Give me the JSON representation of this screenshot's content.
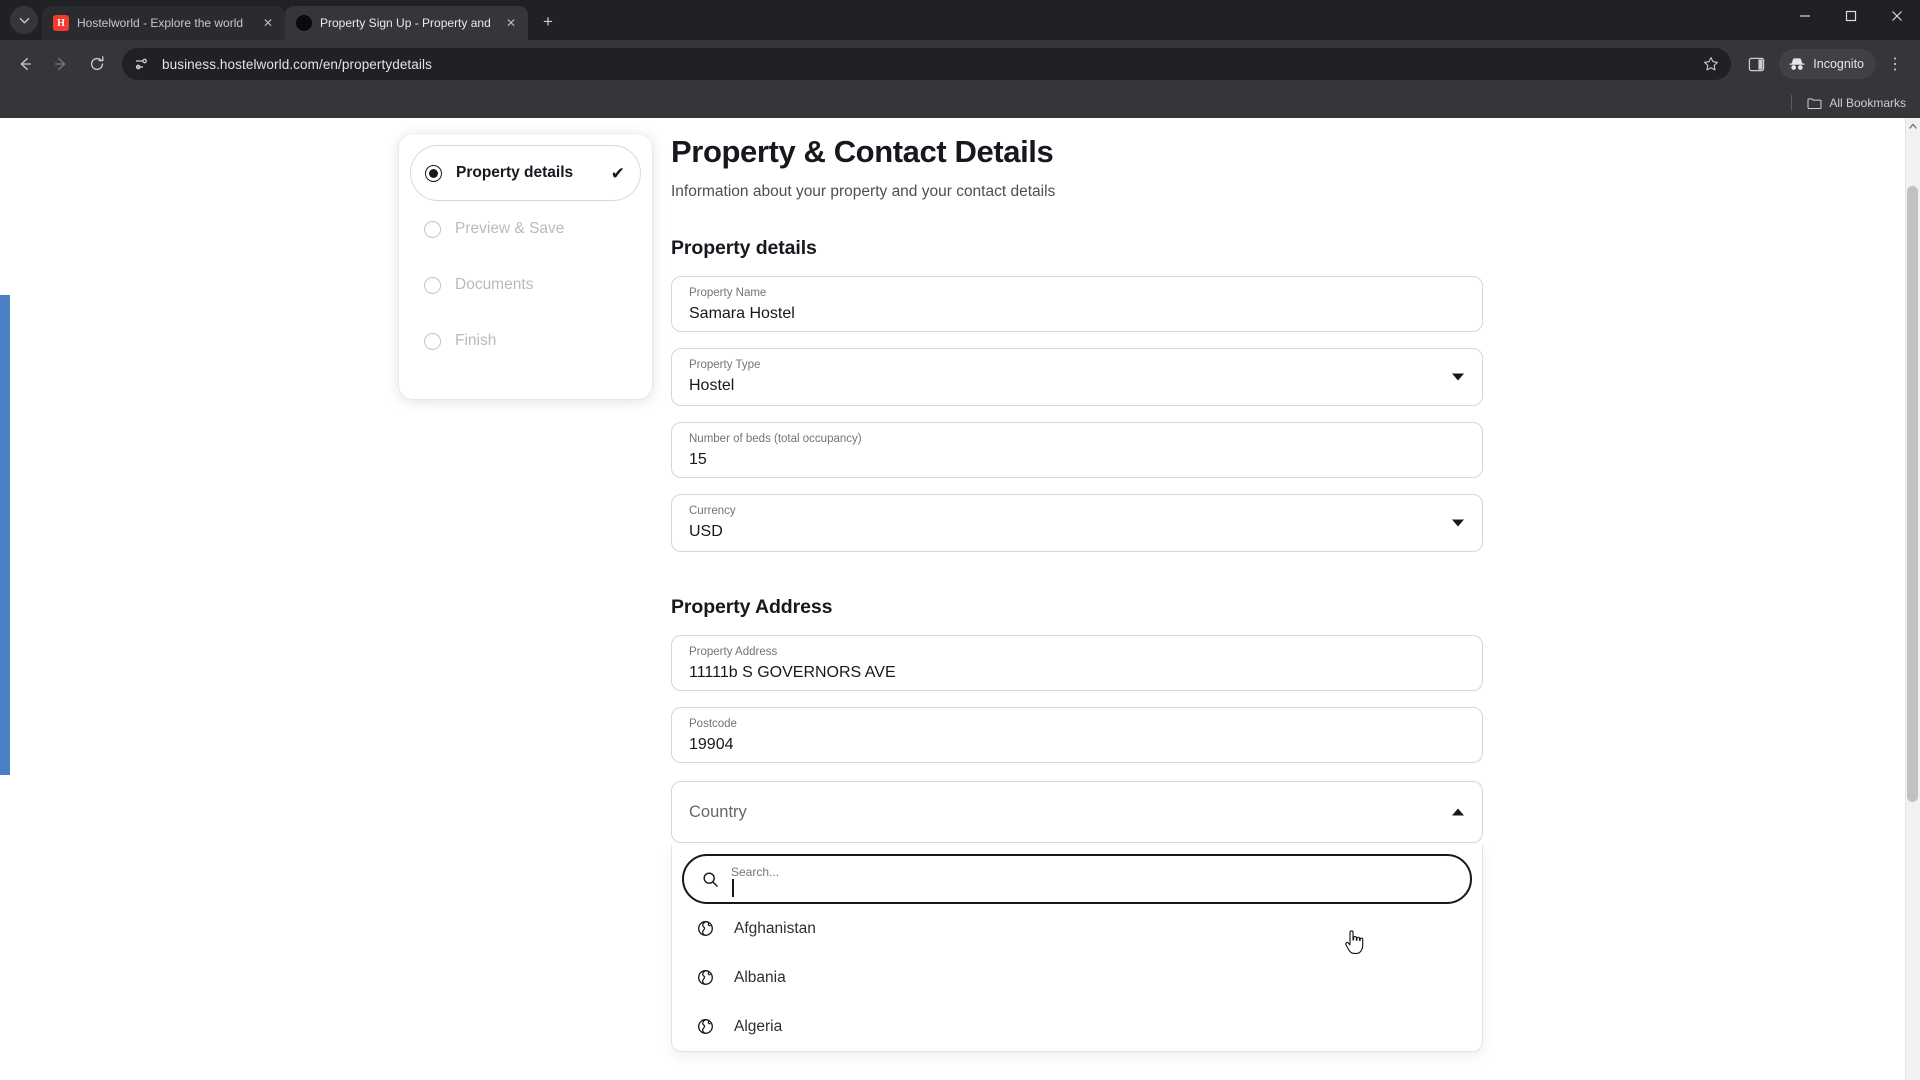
{
  "browser": {
    "tabs": [
      {
        "title": "Hostelworld - Explore the world",
        "favicon": "hostelworld-logo-icon",
        "active": false
      },
      {
        "title": "Property Sign Up - Property and",
        "favicon": "page-dot-icon",
        "active": true
      }
    ],
    "new_tab_label": "+",
    "tab_search_icon": "chevron-down-icon",
    "tab_close_icon": "✕",
    "window_controls": {
      "minimize": "—",
      "maximize": "❐",
      "close": "✕"
    },
    "toolbar": {
      "back_icon": "←",
      "forward_icon": "→",
      "reload_icon": "↻",
      "site_info_icon": "tune-settings-icon",
      "url": "business.hostelworld.com/en/propertydetails",
      "bookmark_icon": "star-icon",
      "side_panel_icon": "side-panel-icon",
      "incognito_label": "Incognito",
      "incognito_icon": "incognito-hat-icon",
      "menu_icon": "⋮"
    },
    "bookmarks_bar": {
      "label": "All Bookmarks",
      "folder_icon": "folder-icon"
    }
  },
  "stepper": {
    "steps": [
      {
        "label": "Property details",
        "state": "current",
        "completed": true,
        "check": "✔"
      },
      {
        "label": "Preview & Save",
        "state": "upcoming",
        "completed": false
      },
      {
        "label": "Documents",
        "state": "upcoming",
        "completed": false
      },
      {
        "label": "Finish",
        "state": "upcoming",
        "completed": false
      }
    ]
  },
  "page": {
    "title": "Property & Contact Details",
    "subtitle": "Information about your property and your contact details",
    "sections": [
      {
        "heading": "Property details"
      },
      {
        "heading": "Property Address"
      }
    ],
    "fields": {
      "property_name": {
        "label": "Property Name",
        "value": "Samara Hostel",
        "type": "text"
      },
      "property_type": {
        "label": "Property Type",
        "value": "Hostel",
        "type": "select",
        "caret": "down"
      },
      "beds": {
        "label": "Number of beds (total occupancy)",
        "value": "15",
        "type": "text"
      },
      "currency": {
        "label": "Currency",
        "value": "USD",
        "type": "select",
        "caret": "down"
      },
      "address": {
        "label": "Property Address",
        "value": "11111b S GOVERNORS AVE",
        "type": "text"
      },
      "postcode": {
        "label": "Postcode",
        "value": "19904",
        "type": "text"
      },
      "country": {
        "label": "Country",
        "value": "",
        "type": "select",
        "caret": "up",
        "expanded": true
      }
    },
    "country_dropdown": {
      "search_placeholder": "Search...",
      "search_value": "",
      "search_icon": "magnifier-icon",
      "options": [
        {
          "label": "Afghanistan",
          "icon": "globe-icon"
        },
        {
          "label": "Albania",
          "icon": "globe-icon"
        },
        {
          "label": "Algeria",
          "icon": "globe-icon"
        }
      ]
    }
  },
  "colors": {
    "accent_blue": "#4a80c4",
    "text_dark": "#16181d",
    "text_muted": "#6f747a",
    "border": "#d5d6d8",
    "chrome_dark": "#35363a",
    "tabstrip": "#202124"
  }
}
